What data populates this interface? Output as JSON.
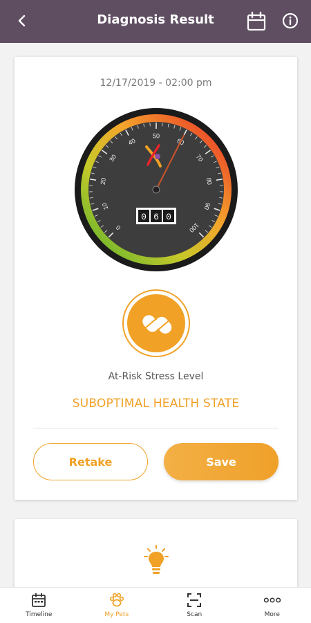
{
  "header": {
    "title": "Diagnosis Result"
  },
  "result": {
    "date": "12/17/2019 - 02:00 pm",
    "gauge": {
      "value": 60,
      "min": 0,
      "max": 100,
      "tick_labels": [
        "0",
        "10",
        "20",
        "30",
        "40",
        "50",
        "60",
        "70",
        "80",
        "90",
        "100"
      ],
      "digits": [
        "0",
        "6",
        "0"
      ]
    },
    "stress_label": "At-Risk Stress Level",
    "state": "SUBOPTIMAL HEALTH STATE",
    "retake_label": "Retake",
    "save_label": "Save"
  },
  "nav": {
    "items": [
      {
        "label": "Timeline",
        "icon": "calendar-icon"
      },
      {
        "label": "My Pets",
        "icon": "paw-icon",
        "active": true
      },
      {
        "label": "Scan",
        "icon": "scan-icon"
      },
      {
        "label": "More",
        "icon": "more-icon"
      }
    ]
  },
  "colors": {
    "header": "#5f4d62",
    "accent": "#f0a126"
  }
}
